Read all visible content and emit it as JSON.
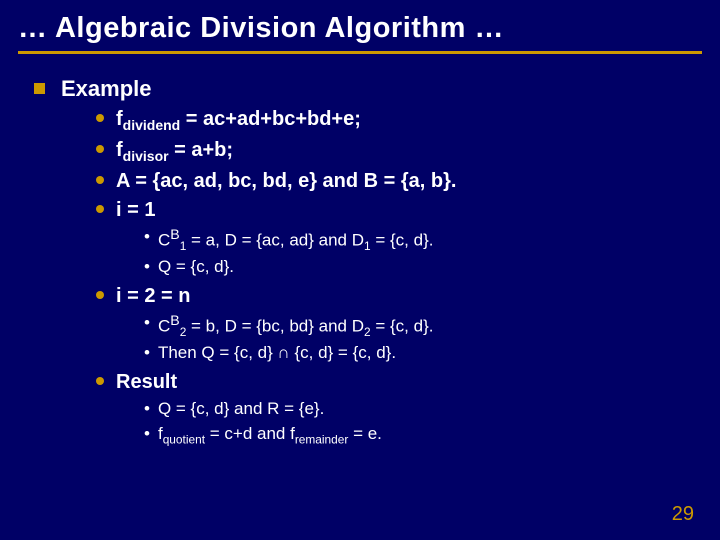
{
  "title": "… Algebraic Division Algorithm …",
  "heading": "Example",
  "items": {
    "dividend_html": "f<sub>dividend</sub> = ac+ad+bc+bd+e;",
    "divisor_html": "f<sub>divisor</sub> = a+b;",
    "sets": "A = {ac, ad, bc, bd, e} and B = {a, b}.",
    "i1": "i = 1",
    "i1_sub1_html": "C<sup>B</sup><sub>1</sub> = a, D = {ac, ad} and D<sub>1</sub> = {c, d}.",
    "i1_sub2": "Q = {c, d}.",
    "i2": "i = 2 = n",
    "i2_sub1_html": "C<sup>B</sup><sub>2</sub> = b, D = {bc, bd} and D<sub>2</sub> = {c, d}.",
    "i2_sub2": "Then Q = {c, d} ∩ {c, d} = {c, d}.",
    "result": "Result",
    "res_sub1": "Q = {c, d} and R = {e}.",
    "res_sub2_html": "f<sub>quotient</sub> = c+d and f<sub>remainder</sub> = e."
  },
  "page_number": "29"
}
